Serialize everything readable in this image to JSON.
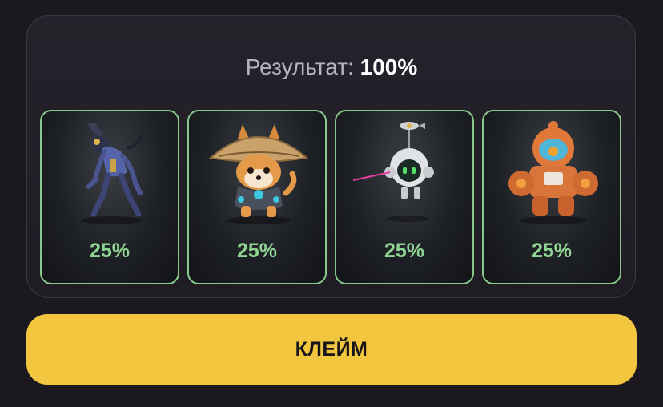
{
  "result": {
    "label": "Результат:",
    "value": "100%"
  },
  "cards": [
    {
      "icon": "robot-werewolf-icon",
      "percent": "25%"
    },
    {
      "icon": "shiba-samurai-icon",
      "percent": "25%"
    },
    {
      "icon": "drone-robot-icon",
      "percent": "25%"
    },
    {
      "icon": "mech-astronaut-icon",
      "percent": "25%"
    }
  ],
  "claim_button": {
    "label": "КЛЕЙМ"
  },
  "colors": {
    "background": "#1b1820",
    "panel_border": "#3d3a44",
    "card_border": "#86c98a",
    "percent_text": "#8ed492",
    "button": "#f2c63f"
  }
}
